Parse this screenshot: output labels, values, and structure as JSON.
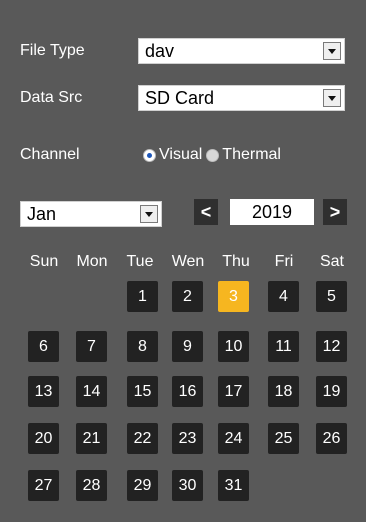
{
  "filter": {
    "file_type_label": "File Type",
    "file_type_value": "dav",
    "data_src_label": "Data Src",
    "data_src_value": "SD Card",
    "channel_label": "Channel",
    "channel_options": [
      {
        "label": "Visual",
        "selected": true
      },
      {
        "label": "Thermal",
        "selected": false
      }
    ]
  },
  "calendar": {
    "month": "Jan",
    "year": "2019",
    "prev_symbol": "<",
    "next_symbol": ">",
    "weekdays": [
      "Sun",
      "Mon",
      "Tue",
      "Wen",
      "Thu",
      "Fri",
      "Sat"
    ],
    "selected_day": 3,
    "days": [
      "1",
      "2",
      "3",
      "4",
      "5",
      "6",
      "7",
      "8",
      "9",
      "10",
      "11",
      "12",
      "13",
      "14",
      "15",
      "16",
      "17",
      "18",
      "19",
      "20",
      "21",
      "22",
      "23",
      "24",
      "25",
      "26",
      "27",
      "28",
      "29",
      "30",
      "31"
    ]
  },
  "colors": {
    "background": "#595959",
    "day_cell": "#222222",
    "selected_day": "#f6b620"
  }
}
